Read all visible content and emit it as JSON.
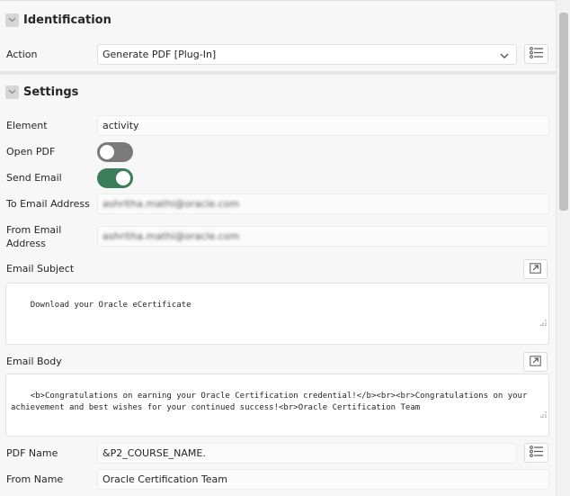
{
  "sections": {
    "identification": {
      "title": "Identification"
    },
    "settings": {
      "title": "Settings"
    }
  },
  "fields": {
    "action": {
      "label": "Action",
      "value": "Generate PDF [Plug-In]"
    },
    "element": {
      "label": "Element",
      "value": "activity"
    },
    "open_pdf": {
      "label": "Open PDF",
      "checked": false
    },
    "send_email": {
      "label": "Send Email",
      "checked": true
    },
    "to_email": {
      "label": "To Email Address",
      "value": "ashritha.mathi@oracle.com"
    },
    "from_email": {
      "label_line1": "From Email",
      "label_line2": "Address",
      "value": "ashritha.mathi@oracle.com"
    },
    "email_subject": {
      "label": "Email Subject",
      "value": "Download your Oracle eCertificate"
    },
    "email_body": {
      "label": "Email Body",
      "value": "<b>Congratulations on earning your Oracle Certification credential!</b><br><br>Congratulations on your achievement and best wishes for your continued success!<br>Oracle Certification Team"
    },
    "pdf_name": {
      "label": "PDF Name",
      "value": "&P2_COURSE_NAME."
    },
    "from_name": {
      "label": "From Name",
      "value": "Oracle Certification Team"
    }
  },
  "icons": {
    "section_toggle": "chevron-down-icon",
    "list": "list-icon",
    "expand": "expand-icon",
    "dropdown": "chevron-down-icon",
    "resize": "resize-handle-icon"
  },
  "colors": {
    "toggle_on": "#3b7d57",
    "toggle_off": "#7a7a7a",
    "panel_bg": "#f7f7f7"
  }
}
